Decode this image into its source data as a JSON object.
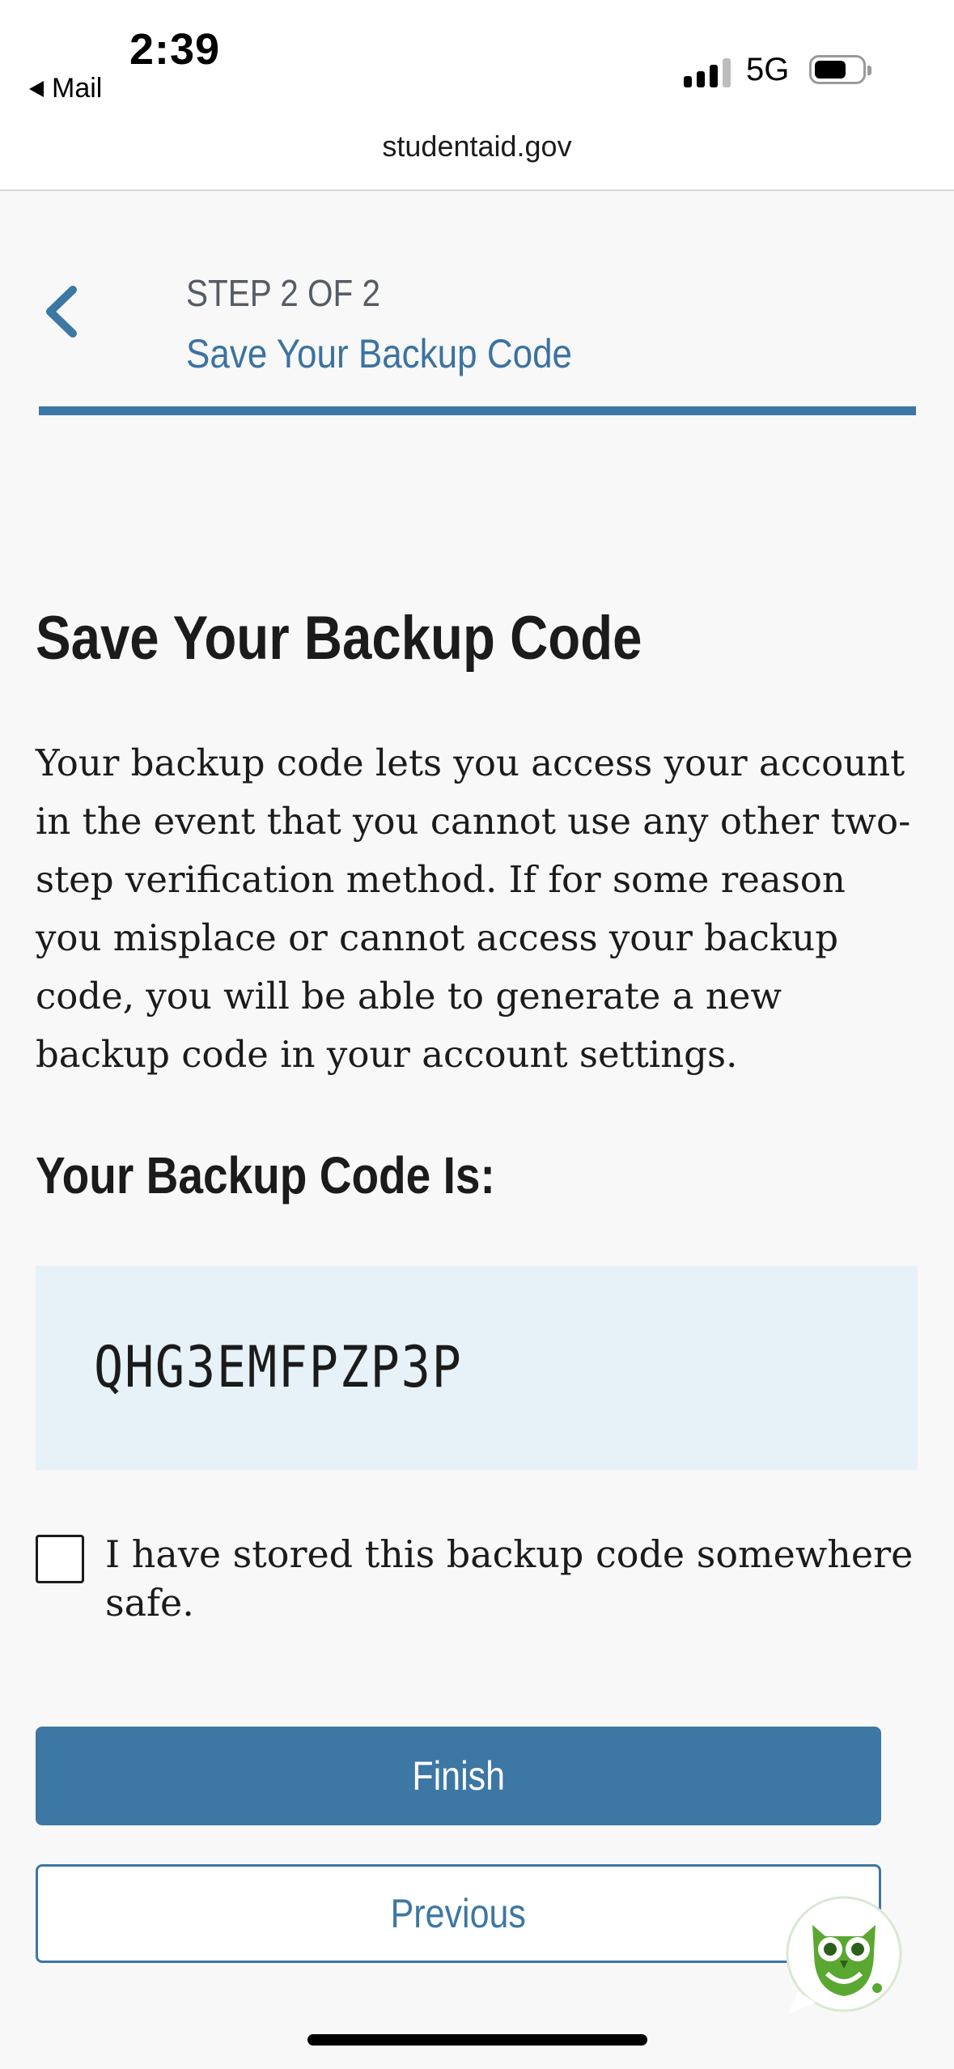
{
  "status_bar": {
    "time": "2:39",
    "back_app": "Mail",
    "network": "5G",
    "signal_icon": "signal-bars-icon",
    "battery_icon": "battery-icon"
  },
  "browser": {
    "url": "studentaid.gov"
  },
  "step_header": {
    "back_icon": "chevron-left-icon",
    "step_label": "STEP 2 OF 2",
    "step_title": "Save Your Backup Code",
    "progress_fraction": 1.0
  },
  "main": {
    "heading": "Save Your Backup Code",
    "description": "Your backup code lets you access your account in the event that you cannot use any other two-step verification method. If for some reason you misplace or cannot access your backup code, you will be able to generate a new backup code in your account settings.",
    "code_heading": "Your Backup Code Is:",
    "backup_code": "QHG3EMFPZP3P",
    "confirm_checkbox": {
      "label": "I have stored this backup code somewhere safe.",
      "checked": false
    },
    "buttons": {
      "finish": "Finish",
      "previous": "Previous"
    }
  },
  "chat_widget": {
    "icon": "owl-chat-icon"
  },
  "colors": {
    "primary": "#3d77a4",
    "code_background": "#e6f2f8",
    "page_background": "#f8f8f8",
    "owl_green": "#5aa832"
  }
}
